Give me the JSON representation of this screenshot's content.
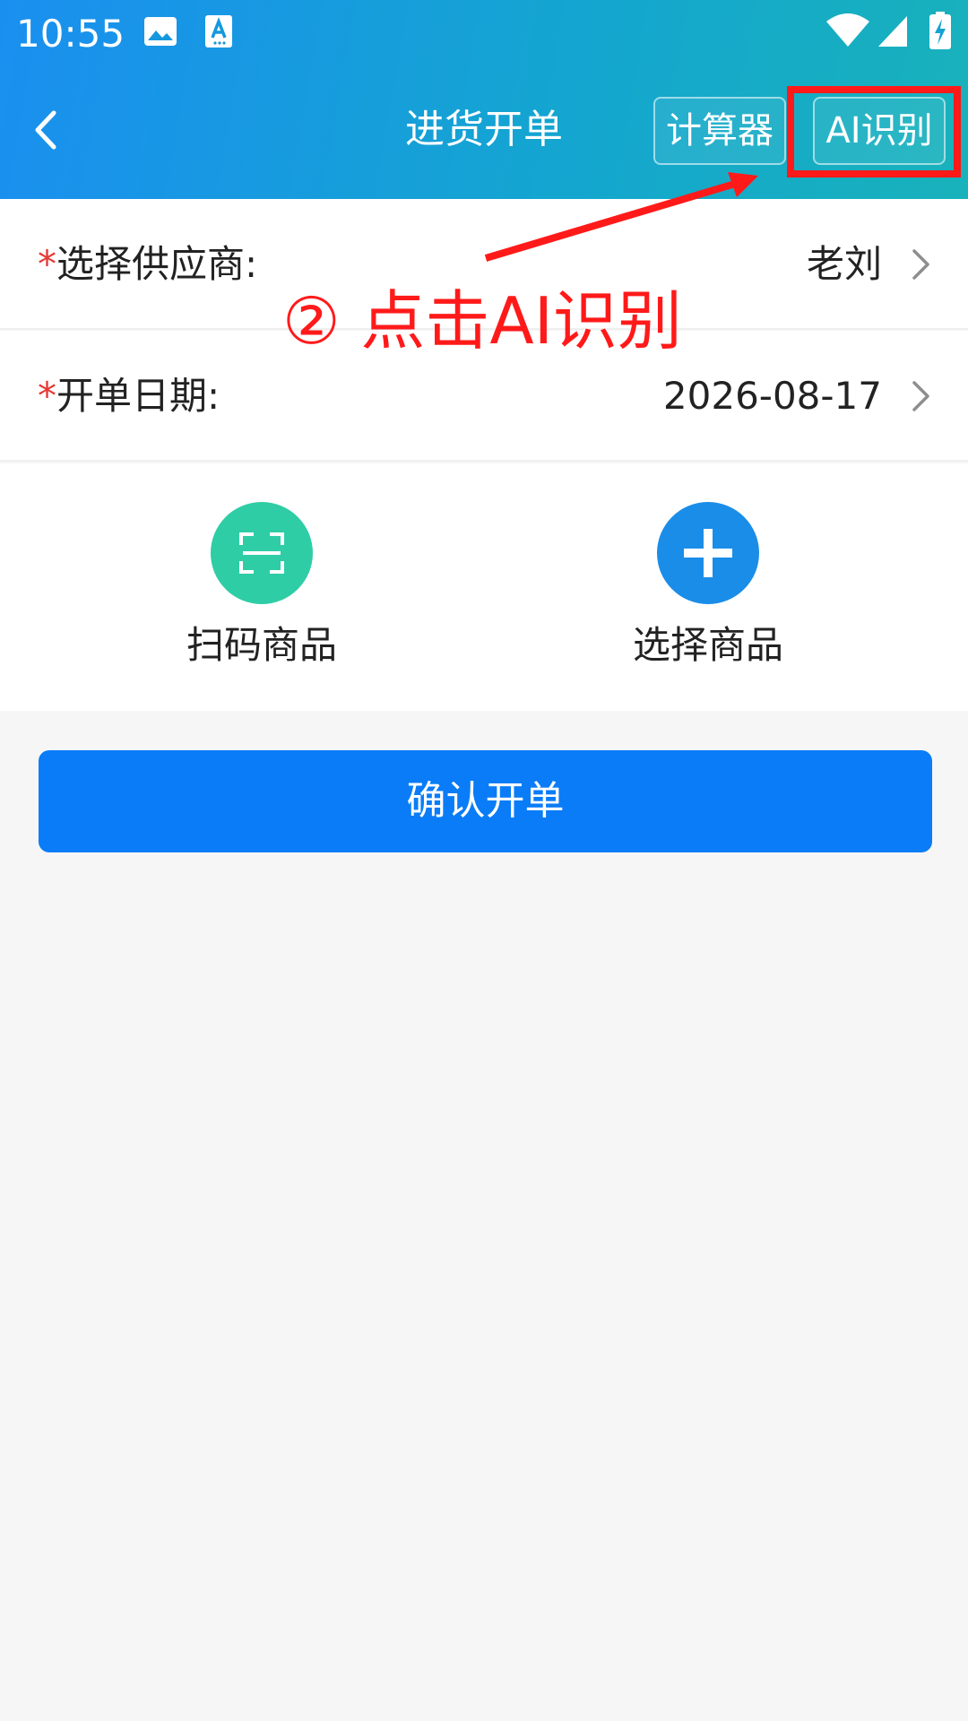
{
  "status_bar": {
    "time": "10:55",
    "icons": [
      "gallery-icon",
      "a-text-icon",
      "wifi-icon",
      "signal-icon",
      "battery-charging-icon"
    ]
  },
  "nav": {
    "title": "进货开单",
    "back_icon": "chevron-left-icon",
    "calculator_label": "计算器",
    "ai_label": "AI识别"
  },
  "form": {
    "required_mark": "*",
    "supplier": {
      "label": "选择供应商:",
      "value": "老刘"
    },
    "date": {
      "label": "开单日期:",
      "value": "2026-08-17"
    },
    "chevron_icon": "chevron-right-icon"
  },
  "actions": {
    "scan": {
      "label": "扫码商品",
      "icon": "scan-frame-icon",
      "color": "#2ecda6"
    },
    "select": {
      "label": "选择商品",
      "icon": "plus-icon",
      "color": "#1a8de8"
    }
  },
  "confirm_label": "确认开单",
  "annotation": {
    "text": "② 点击AI识别",
    "color": "#ff1a1a"
  },
  "colors": {
    "header_start": "#1a8ff0",
    "header_end": "#18b2bb",
    "primary_button": "#0a7cf7",
    "required": "#e53935"
  }
}
